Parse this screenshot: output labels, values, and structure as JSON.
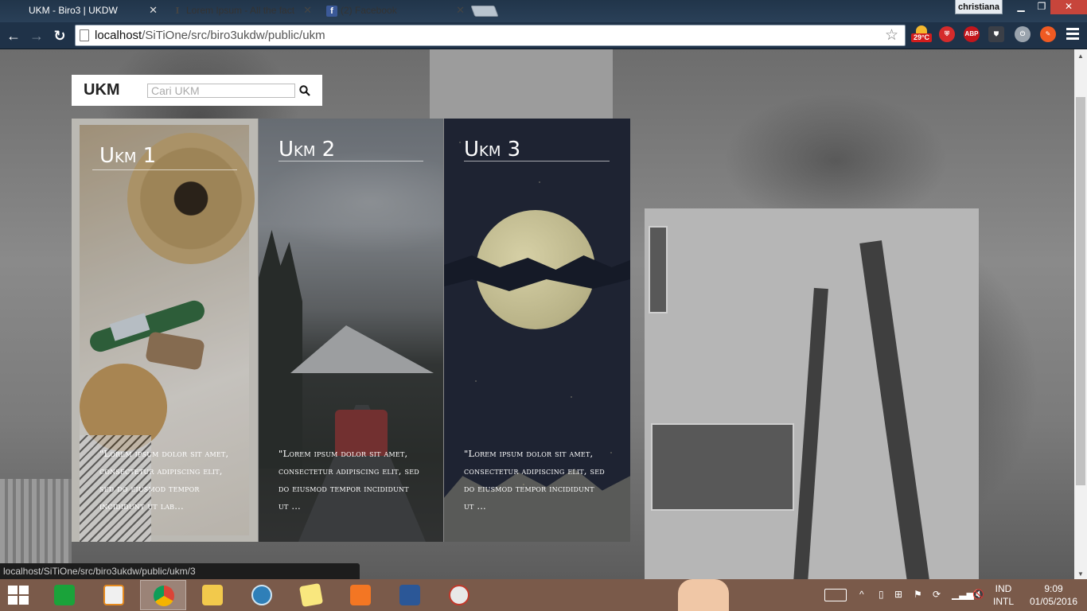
{
  "browser": {
    "tabs": [
      {
        "title": "UKM - Biro3 | UKDW",
        "favicon": "",
        "active": true
      },
      {
        "title": "Lorem Ipsum - All the fact",
        "favicon": "I",
        "active": false
      },
      {
        "title": "(2) Facebook",
        "favicon": "f",
        "active": false
      }
    ],
    "profile_name": "christiana",
    "url_host": "localhost",
    "url_path": "/SiTiOne/src/biro3ukdw/public/ukm",
    "weather_temp": "29°C",
    "extensions": [
      "shield-icon",
      "ABP",
      "crest-icon",
      "power-icon",
      "brush-icon"
    ]
  },
  "page": {
    "brand": "UKM",
    "search_placeholder": "Cari UKM",
    "cards": [
      {
        "title": "Ukm 1",
        "description": "\"Lorem ipsum dolor sit amet, consectetur adipiscing elit, sed do eiusmod tempor incididunt ut lab..."
      },
      {
        "title": "Ukm 2",
        "description": "\"Lorem ipsum dolor sit amet, consectetur adipiscing elit, sed do eiusmod tempor incididunt ut ..."
      },
      {
        "title": "Ukm 3",
        "description": "\"Lorem ipsum dolor sit amet, consectetur adipiscing elit, sed do eiusmod tempor incididunt ut ..."
      }
    ]
  },
  "status_url": "localhost/SiTiOne/src/biro3ukdw/public/ukm/3",
  "taskbar": {
    "apps": [
      "store-icon",
      "media-player-icon",
      "chrome-icon",
      "file-explorer-icon",
      "sourcetree-icon",
      "sticky-notes-icon",
      "xampp-icon",
      "word-icon",
      "paint-icon"
    ],
    "language_top": "IND",
    "language_bottom": "INTL",
    "time": "9:09",
    "date": "01/05/2016"
  }
}
